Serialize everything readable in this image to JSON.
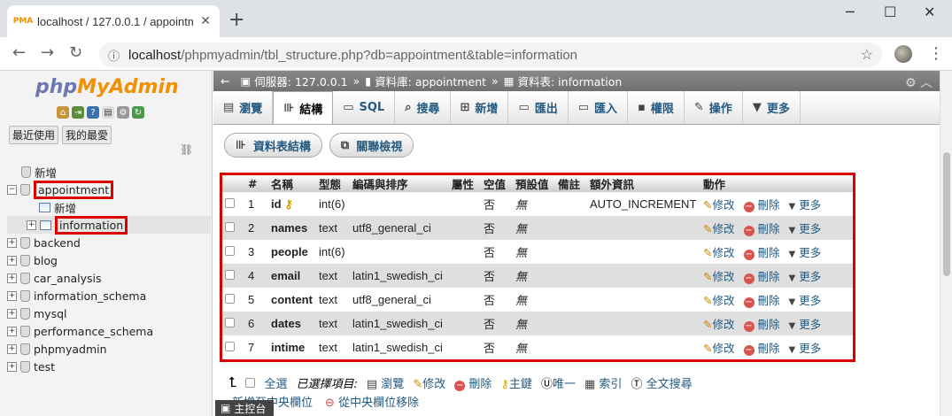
{
  "browser": {
    "tab_title": "localhost / 127.0.0.1 / appointm",
    "favicon": "PMA",
    "url_host": "localhost",
    "url_path": "/phpmyadmin/tbl_structure.php?db=appointment&table=information"
  },
  "sidebar": {
    "logo_php": "php",
    "logo_myadmin": "MyAdmin",
    "recent_label": "最近使用",
    "favorites_label": "我的最愛",
    "tree": [
      {
        "label": "新增",
        "level": 0,
        "type": "new"
      },
      {
        "label": "appointment",
        "level": 0,
        "type": "db",
        "expanded": true
      },
      {
        "label": "新增",
        "level": 1,
        "type": "new-table"
      },
      {
        "label": "information",
        "level": 1,
        "type": "table"
      },
      {
        "label": "backend",
        "level": 0,
        "type": "db"
      },
      {
        "label": "blog",
        "level": 0,
        "type": "db"
      },
      {
        "label": "car_analysis",
        "level": 0,
        "type": "db"
      },
      {
        "label": "information_schema",
        "level": 0,
        "type": "db"
      },
      {
        "label": "mysql",
        "level": 0,
        "type": "db"
      },
      {
        "label": "performance_schema",
        "level": 0,
        "type": "db"
      },
      {
        "label": "phpmyadmin",
        "level": 0,
        "type": "db"
      },
      {
        "label": "test",
        "level": 0,
        "type": "db"
      }
    ]
  },
  "breadcrumb": {
    "server": "伺服器: 127.0.0.1",
    "database": "資料庫: appointment",
    "table": "資料表: information"
  },
  "tabs": [
    {
      "label": "瀏覽",
      "icon": "browse-icon"
    },
    {
      "label": "結構",
      "icon": "structure-icon",
      "active": true
    },
    {
      "label": "SQL",
      "icon": "sql-icon"
    },
    {
      "label": "搜尋",
      "icon": "search-icon"
    },
    {
      "label": "新增",
      "icon": "insert-icon"
    },
    {
      "label": "匯出",
      "icon": "export-icon"
    },
    {
      "label": "匯入",
      "icon": "import-icon"
    },
    {
      "label": "權限",
      "icon": "privileges-icon"
    },
    {
      "label": "操作",
      "icon": "operations-icon"
    },
    {
      "label": "更多",
      "icon": "more-icon"
    }
  ],
  "subtabs": {
    "table_structure": "資料表結構",
    "relation_view": "關聯檢視"
  },
  "columns_header": [
    "#",
    "名稱",
    "型態",
    "編碼與排序",
    "屬性",
    "空值",
    "預設值",
    "備註",
    "額外資訊",
    "動作"
  ],
  "rows": [
    {
      "num": "1",
      "name": "id",
      "type": "int(6)",
      "collation": "",
      "null": "否",
      "default": "無",
      "extra": "AUTO_INCREMENT",
      "primary": true
    },
    {
      "num": "2",
      "name": "names",
      "type": "text",
      "collation": "utf8_general_ci",
      "null": "否",
      "default": "無",
      "extra": ""
    },
    {
      "num": "3",
      "name": "people",
      "type": "int(6)",
      "collation": "",
      "null": "否",
      "default": "無",
      "extra": ""
    },
    {
      "num": "4",
      "name": "email",
      "type": "text",
      "collation": "latin1_swedish_ci",
      "null": "否",
      "default": "無",
      "extra": ""
    },
    {
      "num": "5",
      "name": "content",
      "type": "text",
      "collation": "utf8_general_ci",
      "null": "否",
      "default": "無",
      "extra": ""
    },
    {
      "num": "6",
      "name": "dates",
      "type": "text",
      "collation": "latin1_swedish_ci",
      "null": "否",
      "default": "無",
      "extra": ""
    },
    {
      "num": "7",
      "name": "intime",
      "type": "text",
      "collation": "latin1_swedish_ci",
      "null": "否",
      "default": "無",
      "extra": ""
    }
  ],
  "row_actions": {
    "edit": "修改",
    "drop": "刪除",
    "more": "更多"
  },
  "bottom": {
    "select_all": "全選",
    "with_selected": "已選擇項目:",
    "browse": "瀏覽",
    "edit": "修改",
    "drop": "刪除",
    "primary": "主鍵",
    "unique": "唯一",
    "index": "索引",
    "fulltext": "全文搜尋",
    "add_central": "新增至中央欄位",
    "remove_central": "從中央欄位移除",
    "console": "主控台"
  }
}
